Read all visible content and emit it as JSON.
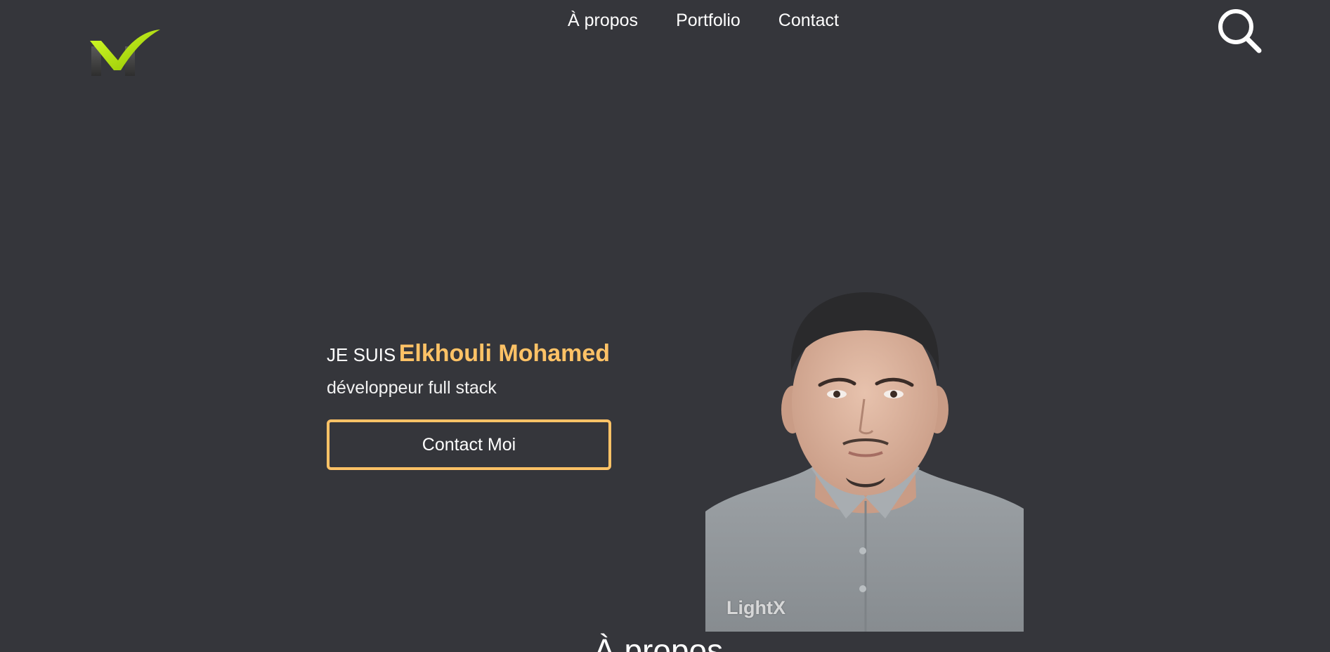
{
  "header": {
    "logo_icon": "checkmark-m-logo-icon",
    "nav": [
      {
        "label": "À propos"
      },
      {
        "label": "Portfolio"
      },
      {
        "label": "Contact"
      }
    ],
    "search_icon": "search-icon"
  },
  "hero": {
    "intro_prefix": "JE SUIS",
    "name": "Elkhouli Mohamed",
    "role": "développeur full stack",
    "cta_label": "Contact Moi",
    "portrait_watermark": "LightX"
  },
  "about": {
    "title": "À propos"
  },
  "colors": {
    "background": "#35363b",
    "accent": "#fec266",
    "logo_green": "#b6e000"
  }
}
